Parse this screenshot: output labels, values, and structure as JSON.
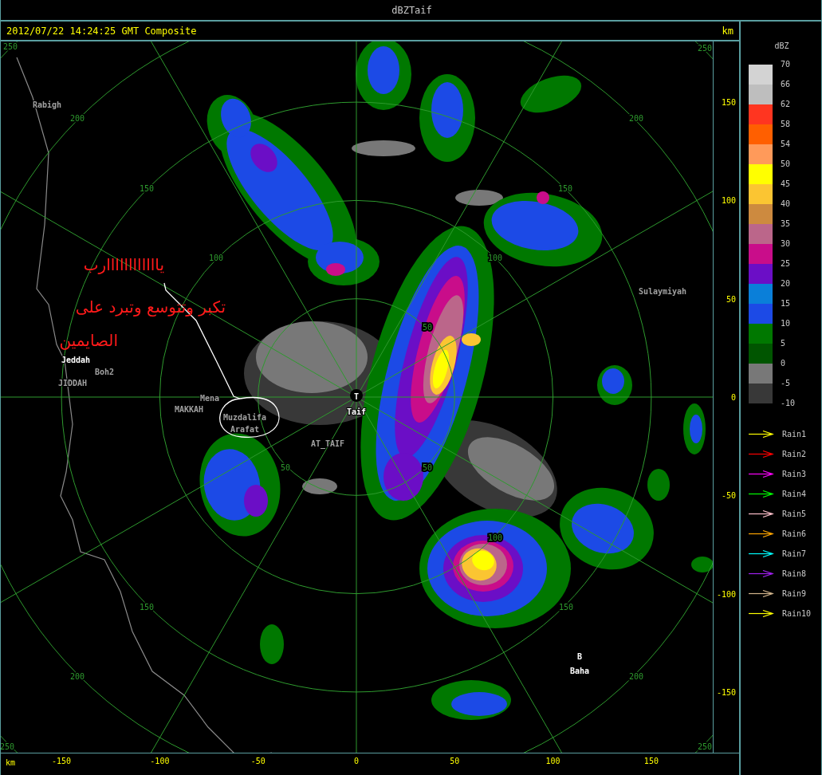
{
  "window": {
    "title": "dBZTaif"
  },
  "header": {
    "timestamp": "2012/07/22 14:24:25 GMT Composite",
    "unit": "km"
  },
  "map": {
    "range_labels": [
      "250",
      "250",
      "200",
      "200",
      "150",
      "150",
      "100",
      "100",
      "50",
      "50",
      "50",
      "100",
      "150",
      "150",
      "200",
      "200",
      "250",
      "250"
    ],
    "places": [
      {
        "name": "Rabigh",
        "color": "#a0a0a0"
      },
      {
        "name": "Sulaymiyah",
        "color": "#a0a0a0"
      },
      {
        "name": "Jeddah",
        "color": "#ffffff"
      },
      {
        "name": "Boh2",
        "color": "#a0a0a0"
      },
      {
        "name": "JIDDAH",
        "color": "#a0a0a0"
      },
      {
        "name": "T",
        "color": "#ffffff"
      },
      {
        "name": "MAKKAH",
        "color": "#a0a0a0"
      },
      {
        "name": "Mena",
        "color": "#a0a0a0"
      },
      {
        "name": "Taif",
        "color": "#ffffff"
      },
      {
        "name": "Muzdalifa",
        "color": "#a0a0a0"
      },
      {
        "name": "Arafat",
        "color": "#a0a0a0"
      },
      {
        "name": "AT_TAIF",
        "color": "#a0a0a0"
      },
      {
        "name": "B",
        "color": "#ffffff"
      },
      {
        "name": "Baha",
        "color": "#ffffff"
      }
    ],
    "annotation": [
      "ياااااااااااارب",
      "تكبر وتتوسع وتبرد على",
      "الصايمين"
    ]
  },
  "y_axis": {
    "ticks": [
      "150",
      "100",
      "50",
      "0",
      "-50",
      "-100",
      "-150"
    ]
  },
  "x_axis": {
    "unit": "km",
    "ticks": [
      "-150",
      "-100",
      "-50",
      "0",
      "50",
      "100",
      "150"
    ]
  },
  "legend": {
    "title": "dBZ",
    "levels": [
      "70",
      "66",
      "62",
      "58",
      "54",
      "50",
      "45",
      "40",
      "35",
      "30",
      "25",
      "20",
      "15",
      "10",
      "5",
      "0",
      "-5",
      "-10"
    ],
    "bins": [
      {
        "color": "#d3d3d3"
      },
      {
        "color": "#bebebe"
      },
      {
        "color": "#ff3520"
      },
      {
        "color": "#ff5f00"
      },
      {
        "color": "#ff9a5a"
      },
      {
        "color": "#ffff00"
      },
      {
        "color": "#fbc532"
      },
      {
        "color": "#cd8a3f"
      },
      {
        "color": "#bb668a"
      },
      {
        "color": "#c90d8a"
      },
      {
        "color": "#6b0ec6"
      },
      {
        "color": "#0a7fd9"
      },
      {
        "color": "#1c4ae6"
      },
      {
        "color": "#007800"
      },
      {
        "color": "#005500"
      },
      {
        "color": "#787878"
      },
      {
        "color": "#383838"
      }
    ]
  },
  "tracks": [
    {
      "label": "Rain1",
      "color": "#ffff00"
    },
    {
      "label": "Rain2",
      "color": "#ff0000"
    },
    {
      "label": "Rain3",
      "color": "#ff00ff"
    },
    {
      "label": "Rain4",
      "color": "#00ff00"
    },
    {
      "label": "Rain5",
      "color": "#ffc0cb"
    },
    {
      "label": "Rain6",
      "color": "#ffa500"
    },
    {
      "label": "Rain7",
      "color": "#00ffff"
    },
    {
      "label": "Rain8",
      "color": "#a020f0"
    },
    {
      "label": "Rain9",
      "color": "#d2b48c"
    },
    {
      "label": "Rain10",
      "color": "#ffff00"
    }
  ]
}
